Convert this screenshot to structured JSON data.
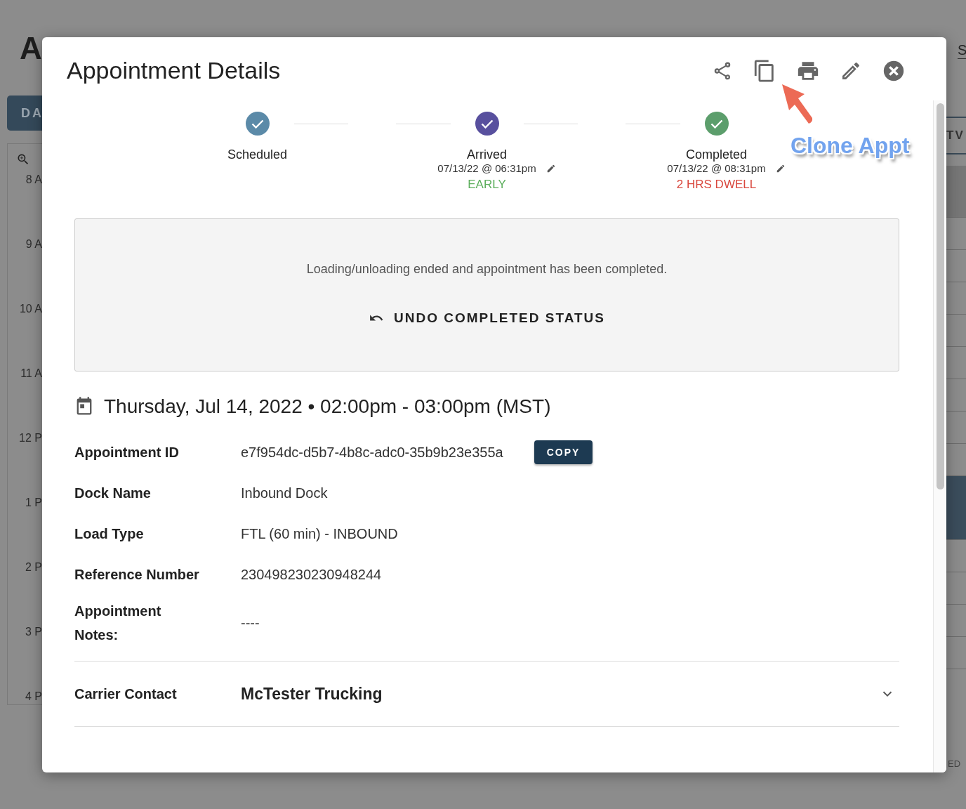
{
  "background_page": {
    "title": "A",
    "tab": "DA",
    "times": [
      "8 A",
      "9 A",
      "10 A",
      "11 A",
      "12 P",
      "1 P",
      "2 P",
      "3 P",
      "4 P"
    ],
    "right_texts": [
      "S",
      "TV",
      "ED"
    ]
  },
  "dialog": {
    "title": "Appointment Details",
    "toolbar": [
      {
        "kind": "share"
      },
      {
        "kind": "clone"
      },
      {
        "kind": "print"
      },
      {
        "kind": "edit"
      },
      {
        "kind": "close"
      }
    ],
    "annotation": {
      "text": "Clone Appt"
    },
    "steps": [
      {
        "label": "Scheduled",
        "color": "#5b8aa8"
      },
      {
        "label": "Arrived",
        "color": "#58509e",
        "time": "07/13/22 @ 06:31pm",
        "note": {
          "text": "EARLY",
          "color": "#5cae5c"
        }
      },
      {
        "label": "Completed",
        "color": "#5c9e6c",
        "time": "07/13/22 @ 08:31pm",
        "note": {
          "text": "2 HRS DWELL",
          "color": "#d9483e"
        }
      }
    ],
    "status_box": {
      "message": "Loading/unloading ended and appointment has been completed.",
      "action": "UNDO COMPLETED STATUS"
    },
    "schedule": "Thursday, Jul 14, 2022 • 02:00pm - 03:00pm (MST)",
    "fields": [
      {
        "label": "Appointment ID",
        "value": "e7f954dc-d5b7-4b8c-adc0-35b9b23e355a",
        "button": "COPY"
      },
      {
        "label": "Dock Name",
        "value": "Inbound Dock"
      },
      {
        "label": "Load Type",
        "value": "FTL (60 min) - INBOUND"
      },
      {
        "label": "Reference Number",
        "value": "230498230230948244"
      },
      {
        "label": "Appointment Notes:",
        "value": "----"
      }
    ],
    "carrier": {
      "label": "Carrier Contact",
      "value": "McTester Trucking",
      "expanded": false
    }
  }
}
